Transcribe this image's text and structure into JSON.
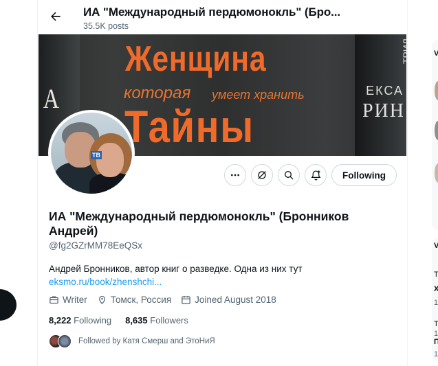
{
  "header": {
    "title": "ИА \"Международный пердюмонокль\" (Бро...",
    "posts": "35.5K posts"
  },
  "banner": {
    "line1": "Женщина",
    "line2a": "которая",
    "line2b": "умеет хранить",
    "line3": "Тайны",
    "left_book_text": "А",
    "right_book_top": "ТРИЛ",
    "right_book_line1": "ЕКСА",
    "right_book_line2": "РИН"
  },
  "avatar": {
    "channel_logo": "ТВ"
  },
  "actions": {
    "follow_label": "Following"
  },
  "profile": {
    "name": "ИА \"Международный пердюмонокль\" (Бронников Андрей)",
    "handle": "@fg2GZrMM78EeQSx",
    "bio_text": "Андрей Бронников, автор книг о разведке. Одна из них тут",
    "bio_link": "eksmo.ru/book/zhenshchi...",
    "profession": "Writer",
    "location": "Томск, Россия",
    "joined": "Joined August 2018",
    "following_count": "8,222",
    "following_label": "Following",
    "followers_count": "8,635",
    "followers_label": "Followers",
    "followed_by": "Followed by Катя Смерш and ЭтоНиЯ"
  },
  "right_column": {
    "glyphs": [
      "V",
      "V",
      "Т",
      "Х",
      "1",
      "Т",
      "1",
      "П",
      "1"
    ]
  }
}
